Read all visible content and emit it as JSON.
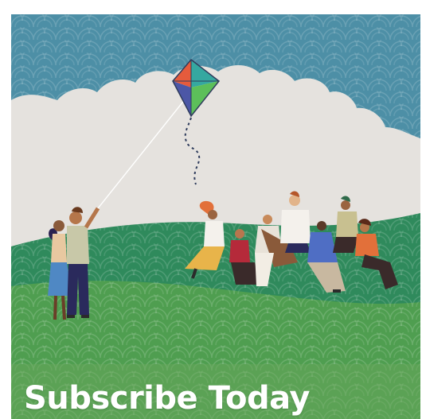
{
  "promo": {
    "headline": "Subscribe Today"
  },
  "colors": {
    "sky": "#4d8fa6",
    "cloud": "#e5e2de",
    "hill_back": "#2f8a5c",
    "hill_front": "#4f9e50",
    "text": "#ffffff"
  },
  "icons": [
    "kite-icon"
  ]
}
